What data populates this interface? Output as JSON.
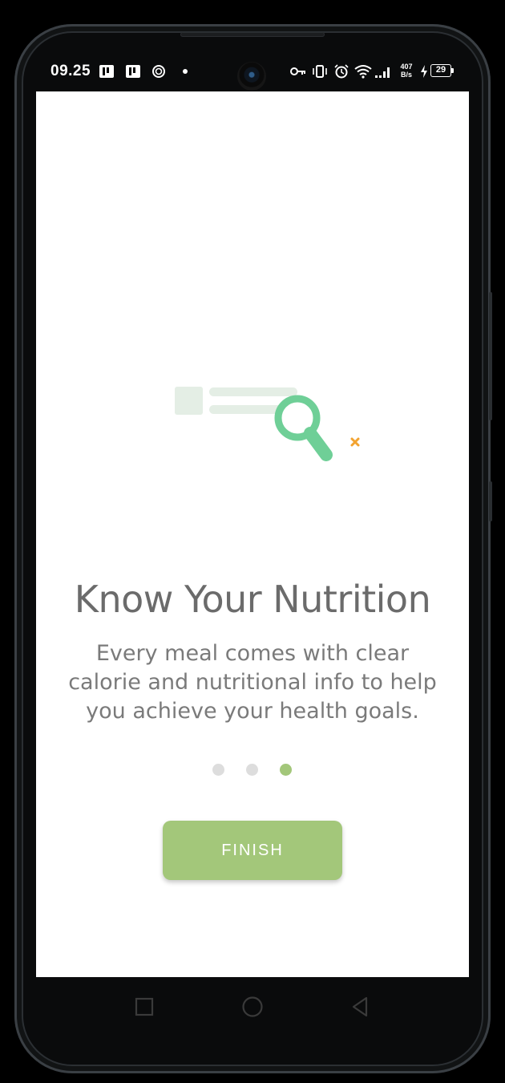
{
  "status_bar": {
    "time": "09.25",
    "network_speed_value": "407",
    "network_speed_unit": "B/s",
    "battery_level": "29",
    "icons": [
      "app-notification-icon",
      "app-notification-icon",
      "sync-icon",
      "notification-dot-icon",
      "vpn-key-icon",
      "vibrate-icon",
      "alarm-icon",
      "wifi-icon",
      "signal-icon",
      "charging-icon",
      "battery-icon"
    ]
  },
  "onboarding": {
    "title": "Know Your Nutrition",
    "description": "Every meal comes with clear calorie and nutritional info to help you achieve your health goals.",
    "illustration": "nutrition-search-illustration",
    "page_indicator": {
      "total": 3,
      "active_index": 2
    },
    "finish_label": "FINISH"
  },
  "navigation_bar": {
    "buttons": [
      "recents-icon",
      "home-icon",
      "back-icon"
    ]
  },
  "colors": {
    "accent_green": "#a3c77a",
    "magnifier_green": "#6fcf97",
    "sparkle_orange": "#f2a330",
    "title_gray": "#6b6b6b",
    "inactive_dot": "#dddddd"
  }
}
